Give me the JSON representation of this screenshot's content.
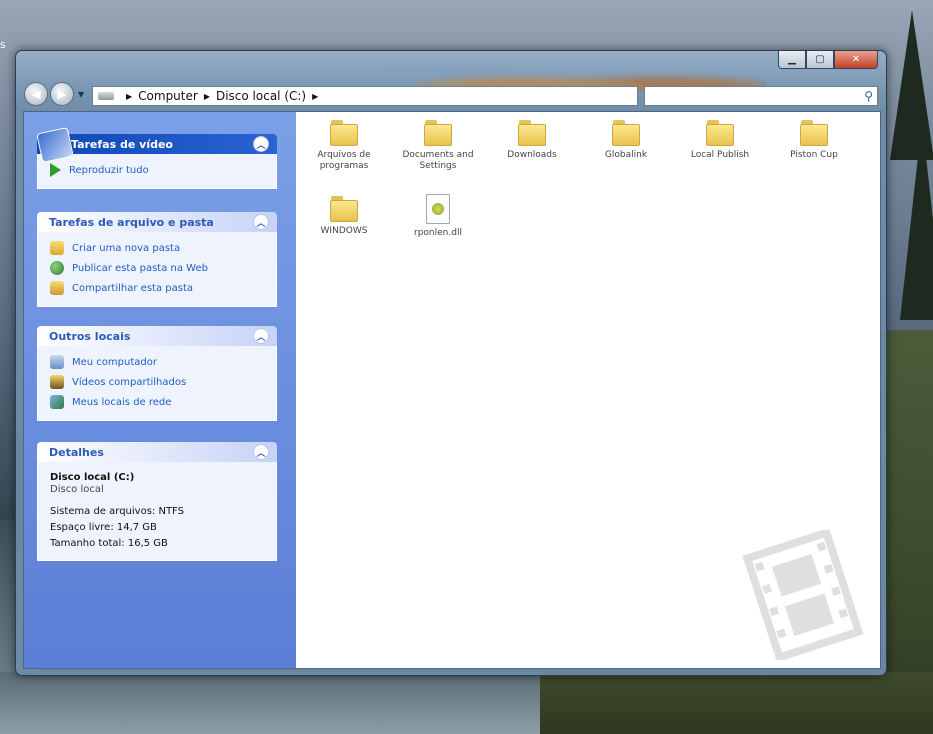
{
  "desktop": {
    "edge_text": "s"
  },
  "window": {
    "caption_buttons": {
      "minimize": "▁",
      "maximize": "▢",
      "close": "✕"
    }
  },
  "address_bar": {
    "breadcrumbs": [
      "Computer",
      "Disco local (C:)"
    ]
  },
  "search": {
    "placeholder": ""
  },
  "sidebar": {
    "video_tasks": {
      "title": "Tarefas de vídeo",
      "items": [
        {
          "label": "Reproduzir tudo",
          "icon": "play-icon"
        }
      ]
    },
    "file_tasks": {
      "title": "Tarefas de arquivo e pasta",
      "items": [
        {
          "label": "Criar uma nova pasta",
          "icon": "new-folder-icon"
        },
        {
          "label": "Publicar esta pasta na Web",
          "icon": "web-publish-icon"
        },
        {
          "label": "Compartilhar esta pasta",
          "icon": "share-folder-icon"
        }
      ]
    },
    "other_places": {
      "title": "Outros locais",
      "items": [
        {
          "label": "Meu computador",
          "icon": "computer-icon"
        },
        {
          "label": "Vídeos compartilhados",
          "icon": "shared-videos-icon"
        },
        {
          "label": "Meus locais de rede",
          "icon": "network-icon"
        }
      ]
    },
    "details": {
      "title": "Detalhes",
      "name": "Disco local (C:)",
      "type": "Disco local",
      "filesystem": "Sistema de arquivos: NTFS",
      "free_space": "Espaço livre: 14,7 GB",
      "total_size": "Tamanho total: 16,5 GB"
    }
  },
  "files": [
    {
      "label": "Arquivos de programas",
      "kind": "folder"
    },
    {
      "label": "Documents and Settings",
      "kind": "folder"
    },
    {
      "label": "Downloads",
      "kind": "folder"
    },
    {
      "label": "Globalink",
      "kind": "folder"
    },
    {
      "label": "Local Publish",
      "kind": "folder"
    },
    {
      "label": "Piston Cup",
      "kind": "folder"
    },
    {
      "label": "WINDOWS",
      "kind": "folder"
    },
    {
      "label": "rponlen.dll",
      "kind": "file"
    }
  ],
  "colors": {
    "sidebar_blue": "#6b8fdf",
    "link_blue": "#215dc6",
    "folder_yellow": "#f3d670"
  }
}
